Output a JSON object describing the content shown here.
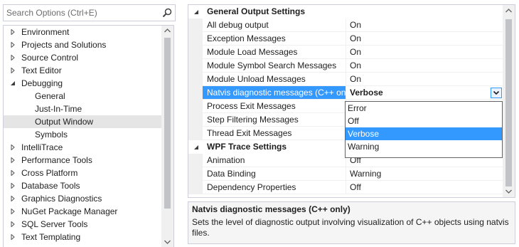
{
  "search": {
    "placeholder": "Search Options (Ctrl+E)",
    "value": ""
  },
  "tree": {
    "items": [
      {
        "label": "Environment",
        "level": 0,
        "expanded": false,
        "selected": false
      },
      {
        "label": "Projects and Solutions",
        "level": 0,
        "expanded": false,
        "selected": false
      },
      {
        "label": "Source Control",
        "level": 0,
        "expanded": false,
        "selected": false
      },
      {
        "label": "Text Editor",
        "level": 0,
        "expanded": false,
        "selected": false
      },
      {
        "label": "Debugging",
        "level": 0,
        "expanded": true,
        "selected": false
      },
      {
        "label": "General",
        "level": 1,
        "selected": false
      },
      {
        "label": "Just-In-Time",
        "level": 1,
        "selected": false
      },
      {
        "label": "Output Window",
        "level": 1,
        "selected": true
      },
      {
        "label": "Symbols",
        "level": 1,
        "selected": false
      },
      {
        "label": "IntelliTrace",
        "level": 0,
        "expanded": false,
        "selected": false
      },
      {
        "label": "Performance Tools",
        "level": 0,
        "expanded": false,
        "selected": false
      },
      {
        "label": "Cross Platform",
        "level": 0,
        "expanded": false,
        "selected": false
      },
      {
        "label": "Database Tools",
        "level": 0,
        "expanded": false,
        "selected": false
      },
      {
        "label": "Graphics Diagnostics",
        "level": 0,
        "expanded": false,
        "selected": false
      },
      {
        "label": "NuGet Package Manager",
        "level": 0,
        "expanded": false,
        "selected": false
      },
      {
        "label": "SQL Server Tools",
        "level": 0,
        "expanded": false,
        "selected": false
      },
      {
        "label": "Text Templating",
        "level": 0,
        "expanded": false,
        "selected": false
      }
    ]
  },
  "grid": {
    "categories": [
      {
        "label": "General Output Settings",
        "rows": [
          {
            "name": "All debug output",
            "value": "On"
          },
          {
            "name": "Exception Messages",
            "value": "On"
          },
          {
            "name": "Module Load Messages",
            "value": "On"
          },
          {
            "name": "Module Symbol Search Messages",
            "value": "On"
          },
          {
            "name": "Module Unload Messages",
            "value": "On"
          },
          {
            "name": "Natvis diagnostic messages (C++ only)",
            "value": "Verbose",
            "active": true
          },
          {
            "name": "Process Exit Messages",
            "value": ""
          },
          {
            "name": "Step Filtering Messages",
            "value": ""
          },
          {
            "name": "Thread Exit Messages",
            "value": ""
          }
        ]
      },
      {
        "label": "WPF Trace Settings",
        "rows": [
          {
            "name": "Animation",
            "value": "Off"
          },
          {
            "name": "Data Binding",
            "value": "Warning"
          },
          {
            "name": "Dependency Properties",
            "value": "Off"
          }
        ]
      }
    ]
  },
  "dropdown": {
    "options": [
      "Error",
      "Off",
      "Verbose",
      "Warning"
    ],
    "highlighted": "Verbose"
  },
  "description": {
    "title": "Natvis diagnostic messages (C++ only)",
    "text": "Sets the level of diagnostic output involving visualization of C++ objects using natvis files."
  },
  "colors": {
    "selection": "#3399ff",
    "tree_selected": "#e5e5e5",
    "border": "#cccedb",
    "scroll_thumb": "#c2c3c9"
  }
}
